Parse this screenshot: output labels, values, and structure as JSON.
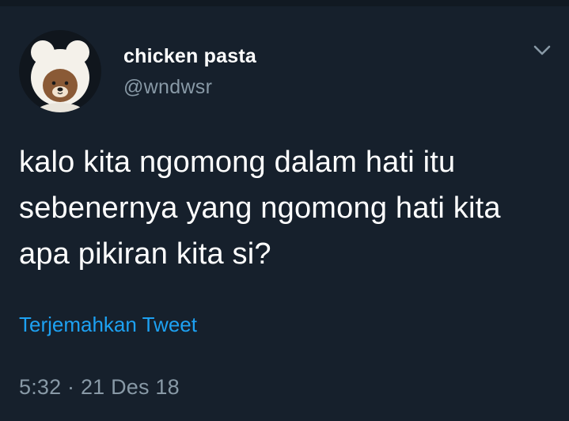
{
  "tweet": {
    "display_name": "chicken pasta",
    "handle": "@wndwsr",
    "text": "kalo kita ngomong dalam hati itu sebenernya yang ngomong hati kita apa pikiran kita si?",
    "translate_label": "Terjemahkan Tweet",
    "timestamp": "5:32 · 21 Des 18"
  },
  "icons": {
    "avatar": "bear-avatar-icon",
    "menu": "chevron-down-icon"
  },
  "colors": {
    "background": "#16202c",
    "text": "#ffffff",
    "secondary_text": "#8899a6",
    "link": "#1da1f2"
  }
}
